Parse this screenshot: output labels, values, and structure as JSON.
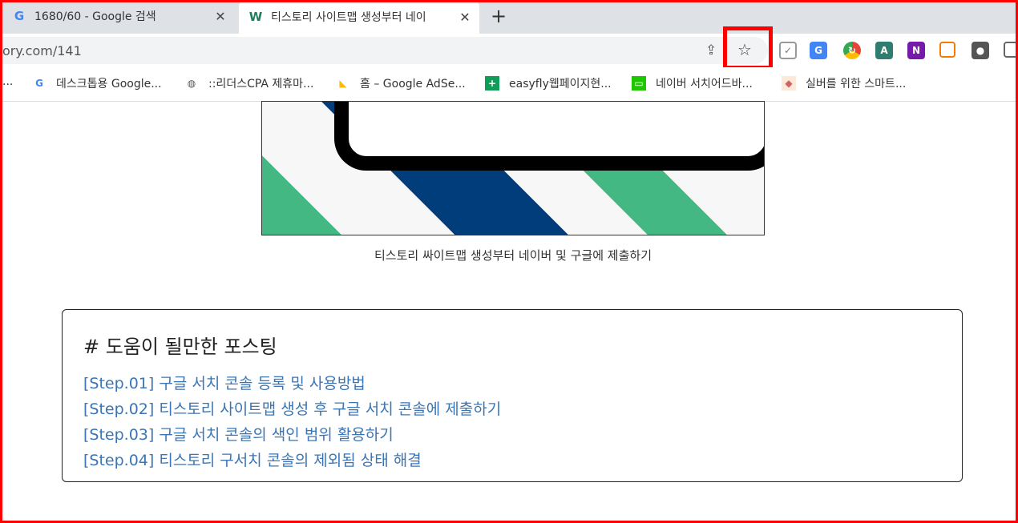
{
  "tabs": [
    {
      "favicon": "google-g-icon",
      "title": "1680/60 - Google 검색",
      "close": "✕"
    },
    {
      "favicon": "w-logo-icon",
      "title": "티스토리 사이트맵 생성부터 네이",
      "close": "✕"
    }
  ],
  "new_tab": "+",
  "address_bar": {
    "url": "ory.com/141"
  },
  "extensions": [
    "pocket-icon",
    "google-translate-icon",
    "chrome-refresh-icon",
    "keyboard-icon",
    "onenote-icon",
    "layout-icon",
    "profile-icon",
    "printer-icon"
  ],
  "bookmarks": [
    {
      "icon": "truncated",
      "label": "..."
    },
    {
      "icon": "google-g-icon",
      "label": "데스크톱용 Google..."
    },
    {
      "icon": "globe-icon",
      "label": "::리더스CPA 제휴마..."
    },
    {
      "icon": "adsense-icon",
      "label": "홈 – Google AdSe..."
    },
    {
      "icon": "plus-green-icon",
      "label": "easyfly웹페이지현..."
    },
    {
      "icon": "monitor-green-icon",
      "label": "네이버 서치어드바..."
    },
    {
      "icon": "silver-icon",
      "label": "실버를 위한 스마트..."
    }
  ],
  "article": {
    "image_caption": "티스토리 싸이트맵 생성부터 네이버 및 구글에 제출하기",
    "box_title": "# 도움이 될만한 포스팅",
    "links": [
      "[Step.01] 구글 서치 콘솔 등록 및 사용방법",
      "[Step.02] 티스토리 사이트맵 생성 후 구글 서치 콘솔에 제출하기",
      "[Step.03] 구글 서치 콘솔의 색인 범위 활용하기",
      "[Step.04] 티스토리 구서치 콘솔의 제외됨 상태 해결"
    ]
  },
  "colors": {
    "highlight": "#ff0000",
    "link": "#3a76b5"
  }
}
